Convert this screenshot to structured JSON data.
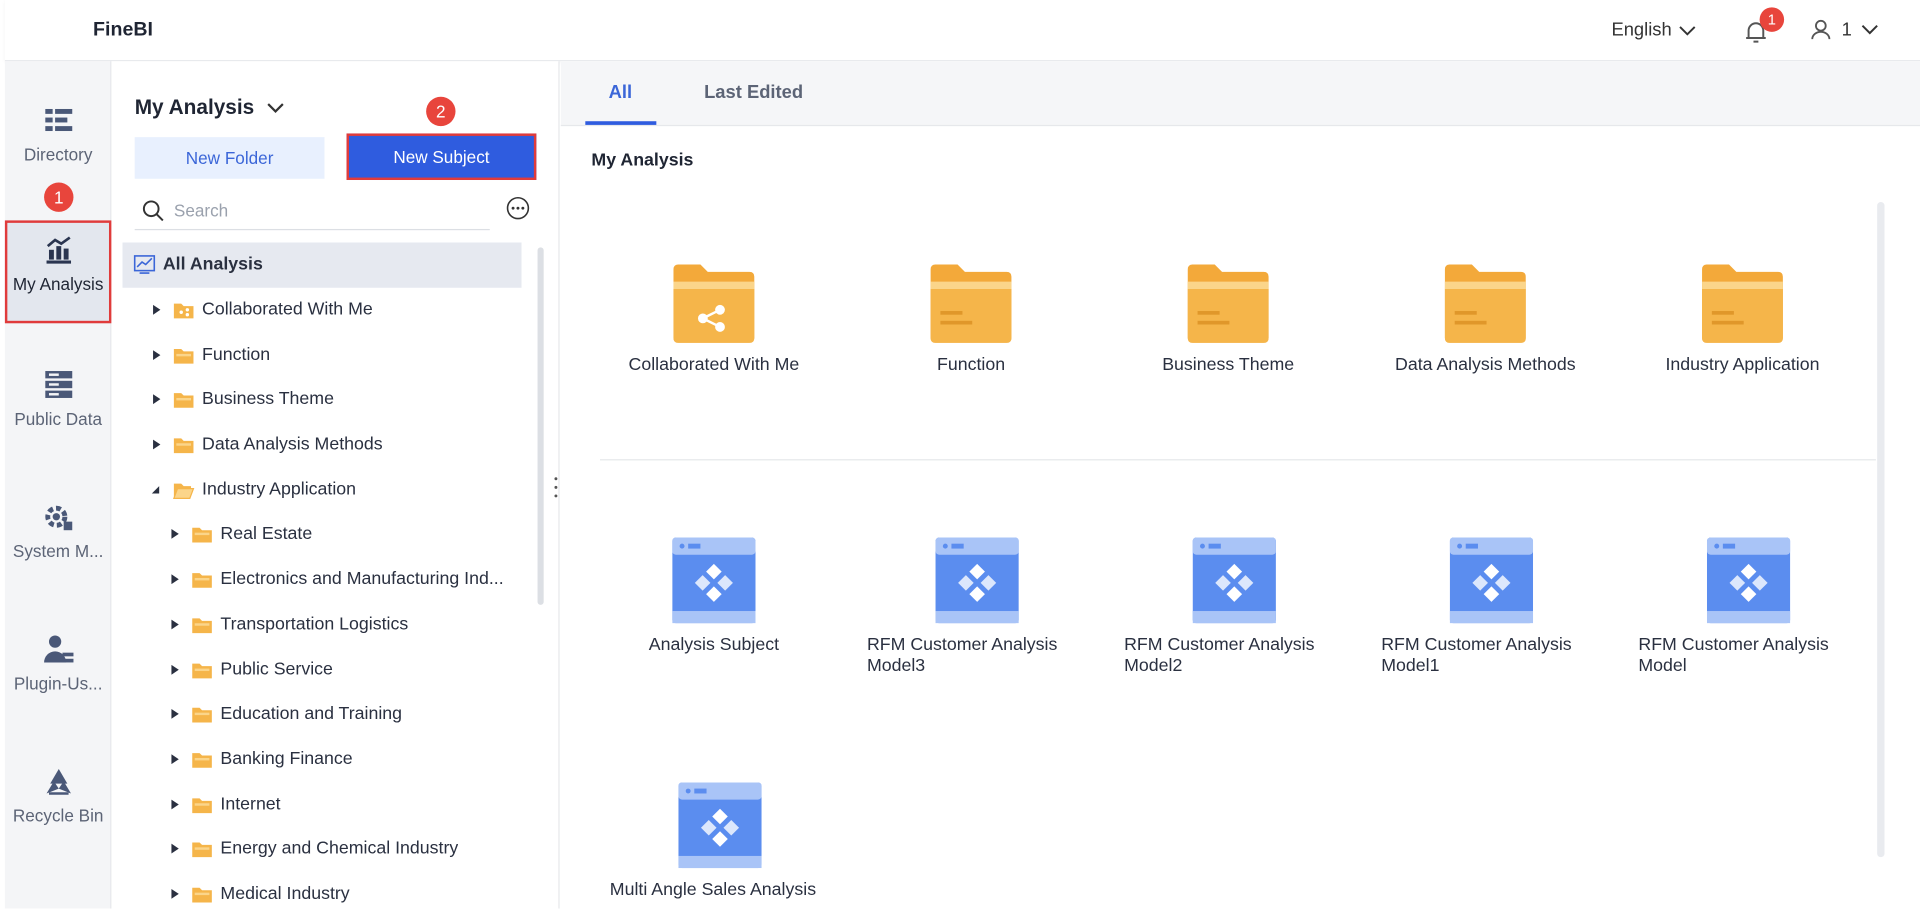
{
  "app": {
    "logo": "FineBI"
  },
  "header": {
    "language": "English",
    "notification_count": "1",
    "user": "1"
  },
  "leftnav": {
    "items": [
      {
        "label": "Directory",
        "icon": "directory-icon"
      },
      {
        "label": "My Analysis",
        "icon": "analysis-chart-icon",
        "active": true
      },
      {
        "label": "Public Data",
        "icon": "database-icon"
      },
      {
        "label": "System M...",
        "icon": "gear-icon"
      },
      {
        "label": "Plugin-Us...",
        "icon": "user-plugin-icon"
      },
      {
        "label": "Recycle Bin",
        "icon": "recycle-bin-icon"
      }
    ],
    "step_badge": "1"
  },
  "treepanel": {
    "title": "My Analysis",
    "new_folder": "New Folder",
    "new_subject": "New Subject",
    "step_badge": "2",
    "search_placeholder": "Search",
    "rows": [
      {
        "label": "All Analysis",
        "level": 0,
        "type": "root"
      },
      {
        "label": "Collaborated With Me",
        "level": 1,
        "type": "folder-shared",
        "expanded": false
      },
      {
        "label": "Function",
        "level": 1,
        "type": "folder",
        "expanded": false
      },
      {
        "label": "Business Theme",
        "level": 1,
        "type": "folder",
        "expanded": false
      },
      {
        "label": "Data Analysis Methods",
        "level": 1,
        "type": "folder",
        "expanded": false
      },
      {
        "label": "Industry Application",
        "level": 1,
        "type": "folder-open",
        "expanded": true
      },
      {
        "label": "Real Estate",
        "level": 2,
        "type": "folder",
        "expanded": false
      },
      {
        "label": "Electronics and Manufacturing Ind...",
        "level": 2,
        "type": "folder",
        "expanded": false
      },
      {
        "label": "Transportation Logistics",
        "level": 2,
        "type": "folder",
        "expanded": false
      },
      {
        "label": "Public Service",
        "level": 2,
        "type": "folder",
        "expanded": false
      },
      {
        "label": "Education and Training",
        "level": 2,
        "type": "folder",
        "expanded": false
      },
      {
        "label": "Banking Finance",
        "level": 2,
        "type": "folder",
        "expanded": false
      },
      {
        "label": "Internet",
        "level": 2,
        "type": "folder",
        "expanded": false
      },
      {
        "label": "Energy and Chemical Industry",
        "level": 2,
        "type": "folder",
        "expanded": false
      },
      {
        "label": "Medical Industry",
        "level": 2,
        "type": "folder",
        "expanded": false
      }
    ]
  },
  "main": {
    "tabs": [
      {
        "label": "All",
        "active": true
      },
      {
        "label": "Last Edited",
        "active": false
      }
    ],
    "section_title": "My Analysis",
    "folders": [
      {
        "label": "Collaborated With Me",
        "shared": true
      },
      {
        "label": "Function"
      },
      {
        "label": "Business Theme"
      },
      {
        "label": "Data Analysis Methods"
      },
      {
        "label": "Industry Application"
      }
    ],
    "subjects": [
      {
        "label": "Analysis Subject"
      },
      {
        "label": "RFM Customer Analysis Model3"
      },
      {
        "label": "RFM Customer Analysis Model2"
      },
      {
        "label": "RFM Customer Analysis Model1"
      },
      {
        "label": "RFM Customer Analysis Model"
      },
      {
        "label": "Multi Angle Sales Analysis"
      }
    ]
  },
  "colors": {
    "accent": "#2f5cdf",
    "highlight": "#e03b3b",
    "folder": "#f5b54a",
    "subject": "#5b8def"
  }
}
